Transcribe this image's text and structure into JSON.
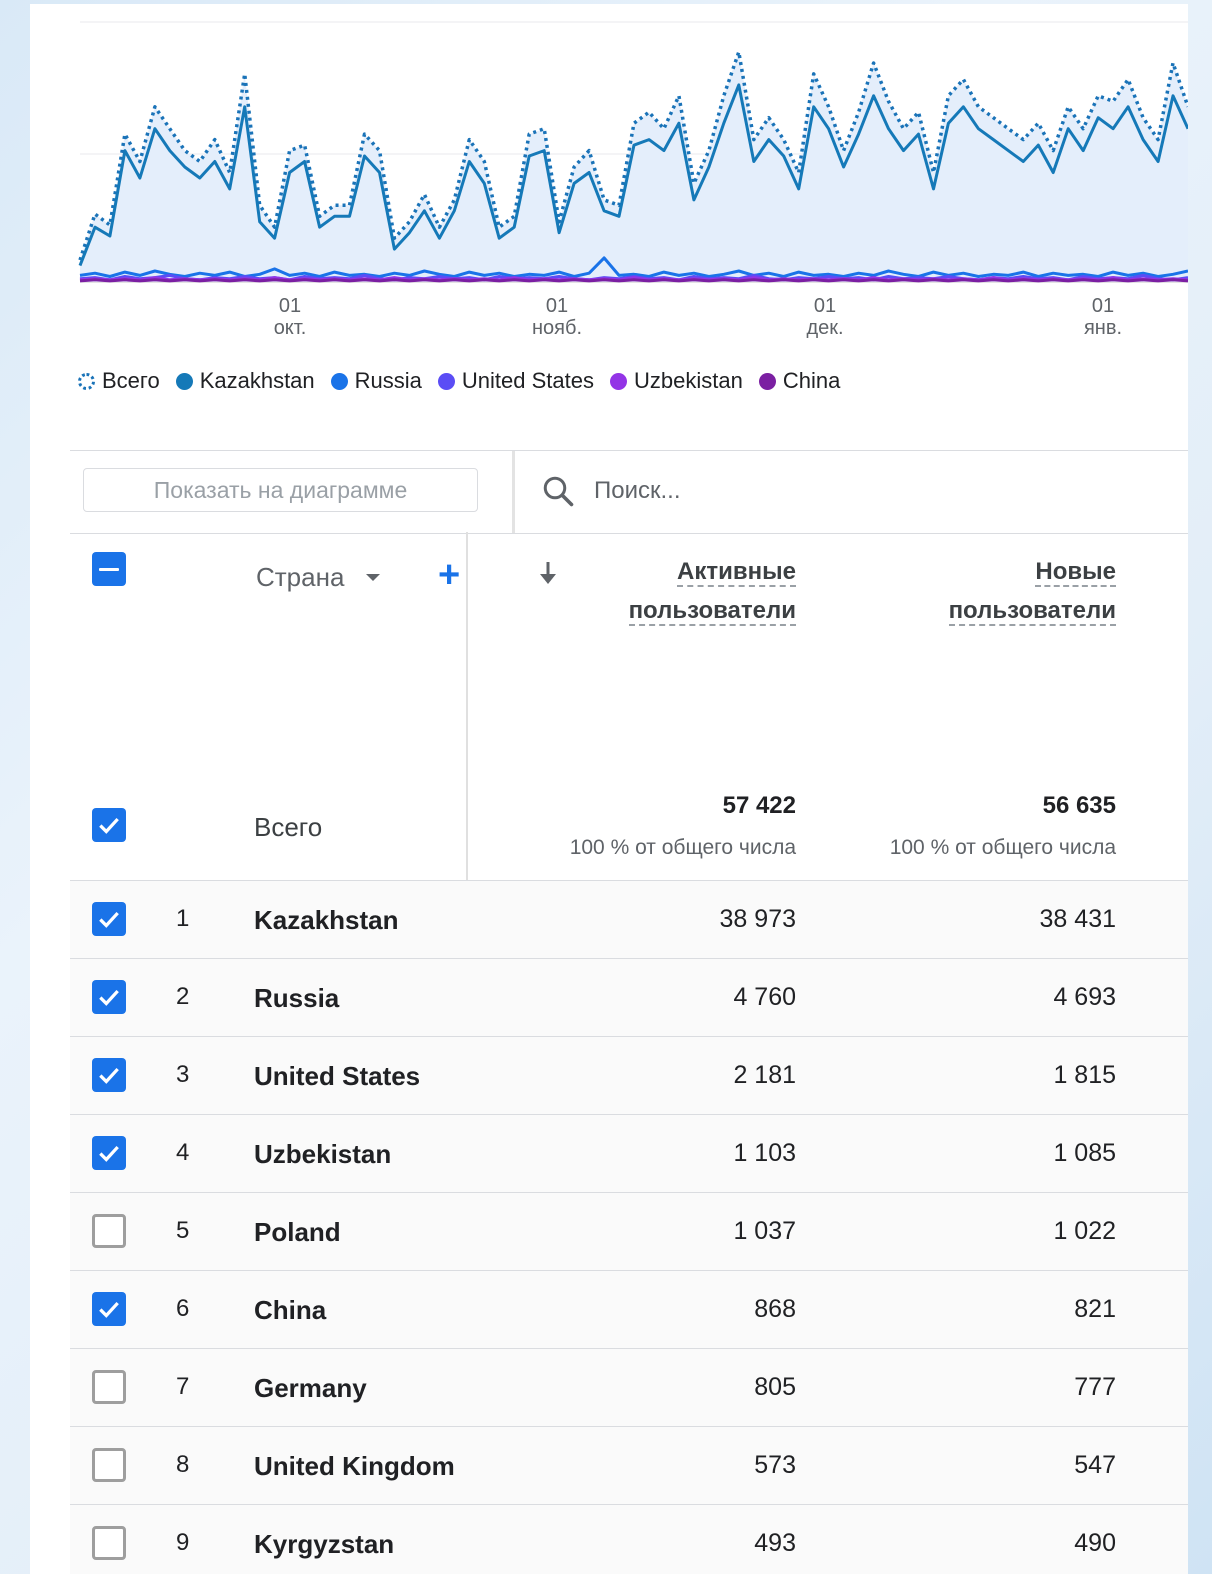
{
  "chart_data": {
    "type": "line",
    "x_ticks": [
      {
        "day": "01",
        "month": "окт."
      },
      {
        "day": "01",
        "month": "нояб."
      },
      {
        "day": "01",
        "month": "дек."
      },
      {
        "day": "01",
        "month": "янв."
      }
    ],
    "series": [
      {
        "name": "Всего",
        "color": "#1a73b8",
        "style": "dotted",
        "values": [
          20,
          62,
          52,
          135,
          110,
          160,
          140,
          120,
          110,
          130,
          100,
          190,
          70,
          50,
          120,
          125,
          60,
          70,
          70,
          135,
          120,
          40,
          55,
          80,
          50,
          75,
          130,
          110,
          50,
          60,
          135,
          140,
          55,
          105,
          120,
          75,
          70,
          145,
          155,
          140,
          170,
          90,
          120,
          170,
          210,
          130,
          150,
          130,
          100,
          190,
          160,
          120,
          155,
          200,
          165,
          140,
          155,
          100,
          170,
          185,
          160,
          150,
          140,
          130,
          145,
          120,
          160,
          140,
          170,
          165,
          185,
          150,
          130,
          200,
          160
        ]
      },
      {
        "name": "Kazakhstan",
        "color": "#1579b8",
        "style": "solid",
        "values": [
          15,
          50,
          42,
          120,
          95,
          140,
          120,
          105,
          95,
          110,
          85,
          160,
          55,
          40,
          100,
          110,
          50,
          60,
          60,
          115,
          100,
          30,
          45,
          65,
          40,
          65,
          110,
          90,
          40,
          50,
          115,
          120,
          45,
          90,
          100,
          65,
          60,
          125,
          130,
          120,
          145,
          75,
          105,
          145,
          180,
          110,
          130,
          115,
          85,
          160,
          140,
          105,
          135,
          170,
          140,
          120,
          135,
          85,
          145,
          160,
          140,
          130,
          120,
          110,
          125,
          100,
          140,
          120,
          150,
          140,
          160,
          130,
          110,
          170,
          140
        ]
      },
      {
        "name": "Russia",
        "color": "#1a73e8",
        "style": "solid",
        "values": [
          6,
          8,
          5,
          9,
          6,
          10,
          7,
          5,
          8,
          6,
          9,
          5,
          7,
          12,
          6,
          8,
          5,
          9,
          6,
          7,
          5,
          8,
          6,
          10,
          7,
          5,
          9,
          6,
          8,
          5,
          7,
          6,
          9,
          5,
          8,
          22,
          6,
          7,
          5,
          9,
          6,
          8,
          5,
          7,
          10,
          6,
          8,
          5,
          9,
          6,
          7,
          5,
          8,
          6,
          10,
          7,
          5,
          9,
          6,
          8,
          5,
          7,
          6,
          9,
          5,
          8,
          6,
          7,
          5,
          9,
          6,
          8,
          5,
          7,
          10
        ]
      },
      {
        "name": "United States",
        "color": "#5b4df5",
        "style": "solid",
        "values": [
          3,
          4,
          2,
          5,
          3,
          4,
          6,
          3,
          2,
          4,
          3,
          5,
          3,
          4,
          2,
          5,
          3,
          4,
          3,
          6,
          3,
          2,
          4,
          3,
          5,
          3,
          4,
          2,
          5,
          3,
          4,
          3,
          5,
          3,
          2,
          4,
          3,
          5,
          3,
          4,
          2,
          5,
          3,
          4,
          3,
          6,
          3,
          2,
          4,
          3,
          5,
          3,
          4,
          2,
          5,
          3,
          4,
          3,
          5,
          3,
          2,
          4,
          3,
          5,
          3,
          4,
          2,
          5,
          3,
          4,
          3,
          6,
          3,
          2,
          4
        ]
      },
      {
        "name": "Uzbekistan",
        "color": "#9334e6",
        "style": "solid",
        "values": [
          2,
          3,
          2,
          3,
          2,
          4,
          2,
          3,
          2,
          3,
          2,
          3,
          2,
          4,
          2,
          3,
          2,
          3,
          2,
          3,
          2,
          4,
          2,
          3,
          2,
          3,
          2,
          3,
          2,
          4,
          2,
          3,
          2,
          3,
          2,
          3,
          2,
          4,
          2,
          3,
          2,
          3,
          2,
          3,
          2,
          4,
          2,
          3,
          2,
          3,
          2,
          3,
          2,
          4,
          2,
          3,
          2,
          3,
          2,
          3,
          2,
          4,
          2,
          3,
          2,
          3,
          2,
          3,
          2,
          4,
          2,
          3,
          2,
          3,
          2
        ]
      },
      {
        "name": "China",
        "color": "#7b1fa2",
        "style": "solid",
        "values": [
          1,
          2,
          1,
          2,
          1,
          2,
          1,
          2,
          1,
          2,
          1,
          2,
          1,
          2,
          1,
          2,
          1,
          2,
          1,
          2,
          1,
          2,
          1,
          2,
          1,
          2,
          1,
          2,
          1,
          2,
          1,
          2,
          1,
          2,
          1,
          2,
          1,
          2,
          1,
          2,
          1,
          2,
          1,
          2,
          1,
          2,
          1,
          2,
          1,
          2,
          1,
          2,
          1,
          2,
          1,
          2,
          1,
          2,
          1,
          2,
          1,
          2,
          1,
          2,
          1,
          2,
          1,
          2,
          1,
          2,
          1,
          2,
          1,
          2,
          1
        ]
      }
    ]
  },
  "toolbar": {
    "show_on_chart": "Показать на диаграмме",
    "search_placeholder": "Поиск..."
  },
  "table": {
    "dimension": "Страна",
    "metrics": [
      {
        "line1": "Активные",
        "line2": "пользователи"
      },
      {
        "line1": "Новые",
        "line2": "пользователи"
      }
    ],
    "total": {
      "label": "Всего",
      "active": "57 422",
      "active_sub": "100 % от общего числа",
      "new": "56 635",
      "new_sub": "100 % от общего числа"
    },
    "rows": [
      {
        "idx": "1",
        "country": "Kazakhstan",
        "active": "38 973",
        "new": "38 431",
        "checked": true
      },
      {
        "idx": "2",
        "country": "Russia",
        "active": "4 760",
        "new": "4 693",
        "checked": true
      },
      {
        "idx": "3",
        "country": "United States",
        "active": "2 181",
        "new": "1 815",
        "checked": true
      },
      {
        "idx": "4",
        "country": "Uzbekistan",
        "active": "1 103",
        "new": "1 085",
        "checked": true
      },
      {
        "idx": "5",
        "country": "Poland",
        "active": "1 037",
        "new": "1 022",
        "checked": false
      },
      {
        "idx": "6",
        "country": "China",
        "active": "868",
        "new": "821",
        "checked": true
      },
      {
        "idx": "7",
        "country": "Germany",
        "active": "805",
        "new": "777",
        "checked": false
      },
      {
        "idx": "8",
        "country": "United Kingdom",
        "active": "573",
        "new": "547",
        "checked": false
      },
      {
        "idx": "9",
        "country": "Kyrgyzstan",
        "active": "493",
        "new": "490",
        "checked": false
      }
    ]
  }
}
